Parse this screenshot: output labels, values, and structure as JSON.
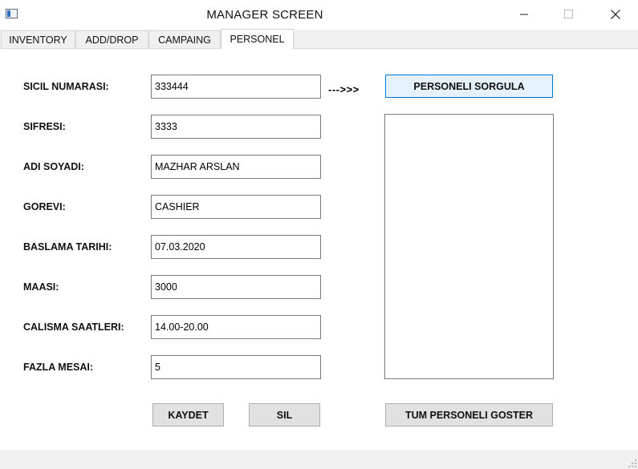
{
  "window": {
    "title": "MANAGER SCREEN"
  },
  "tabs": [
    {
      "label": "INVENTORY"
    },
    {
      "label": "ADD/DROP"
    },
    {
      "label": "CAMPAING"
    },
    {
      "label": "PERSONEL"
    }
  ],
  "active_tab": "PERSONEL",
  "form": {
    "fields": [
      {
        "label": "SICIL NUMARASI:",
        "value": "333444"
      },
      {
        "label": "SIFRESI:",
        "value": "3333"
      },
      {
        "label": "ADI SOYADI:",
        "value": "MAZHAR ARSLAN"
      },
      {
        "label": "GOREVI:",
        "value": "CASHIER"
      },
      {
        "label": "BASLAMA TARIHI:",
        "value": "07.03.2020"
      },
      {
        "label": "MAASI:",
        "value": "3000"
      },
      {
        "label": "CALISMA SAATLERI:",
        "value": "14.00-20.00"
      },
      {
        "label": "FAZLA MESAI:",
        "value": "5"
      }
    ],
    "arrow_text": "--->>>"
  },
  "buttons": {
    "query": "PERSONELI SORGULA",
    "save": "KAYDET",
    "delete": "SIL",
    "show_all": "TUM PERSONELI GOSTER"
  },
  "colors": {
    "focus_border": "#0078d7",
    "focus_fill": "#e5f1fb",
    "button_fill": "#e1e1e1"
  }
}
